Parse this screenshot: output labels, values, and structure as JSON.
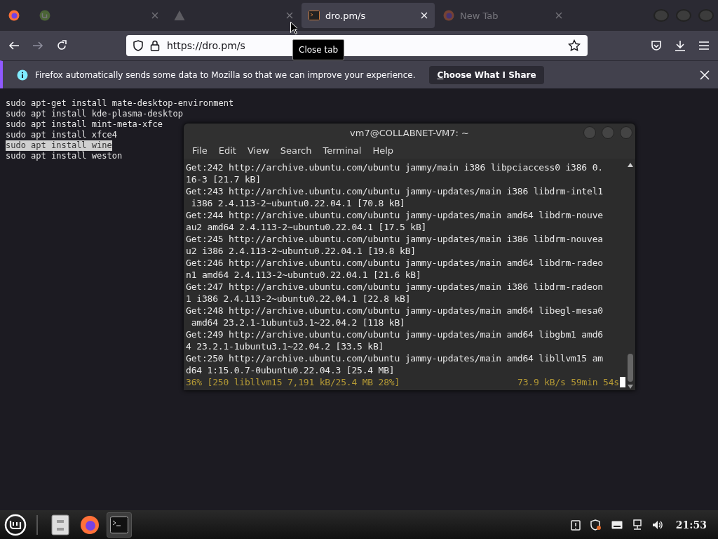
{
  "browser": {
    "tabs": [
      {
        "kind": "mint",
        "selected": false
      },
      {
        "kind": "warning",
        "selected": false
      },
      {
        "kind": "terminal",
        "title": "dro.pm/s",
        "selected": true
      },
      {
        "kind": "firefox",
        "title": "New Tab",
        "selected": false
      }
    ],
    "url": "https://dro.pm/s",
    "tooltip": "Close tab",
    "notification": {
      "message": "Firefox automatically sends some data to Mozilla so that we can improve your experience.",
      "button": "Choose What I Share"
    }
  },
  "page_lines": [
    {
      "text": "sudo apt-get install mate-desktop-environment",
      "selected": false
    },
    {
      "text": "sudo apt install kde-plasma-desktop",
      "selected": false
    },
    {
      "text": "sudo apt install mint-meta-xfce",
      "selected": false
    },
    {
      "text": "sudo apt install xfce4",
      "selected": false
    },
    {
      "text": "sudo apt install wine",
      "selected": true
    },
    {
      "text": "sudo apt install weston",
      "selected": false
    }
  ],
  "terminal": {
    "title": "vm7@COLLABNET-VM7: ~",
    "menu": [
      "File",
      "Edit",
      "View",
      "Search",
      "Terminal",
      "Help"
    ],
    "lines": [
      "Get:242 http://archive.ubuntu.com/ubuntu jammy/main i386 libpciaccess0 i386 0.",
      "16-3 [21.7 kB]",
      "Get:243 http://archive.ubuntu.com/ubuntu jammy-updates/main i386 libdrm-intel1",
      " i386 2.4.113-2~ubuntu0.22.04.1 [70.8 kB]",
      "Get:244 http://archive.ubuntu.com/ubuntu jammy-updates/main amd64 libdrm-nouve",
      "au2 amd64 2.4.113-2~ubuntu0.22.04.1 [17.5 kB]",
      "Get:245 http://archive.ubuntu.com/ubuntu jammy-updates/main i386 libdrm-nouvea",
      "u2 i386 2.4.113-2~ubuntu0.22.04.1 [19.8 kB]",
      "Get:246 http://archive.ubuntu.com/ubuntu jammy-updates/main amd64 libdrm-radeo",
      "n1 amd64 2.4.113-2~ubuntu0.22.04.1 [21.6 kB]",
      "Get:247 http://archive.ubuntu.com/ubuntu jammy-updates/main i386 libdrm-radeon",
      "1 i386 2.4.113-2~ubuntu0.22.04.1 [22.8 kB]",
      "Get:248 http://archive.ubuntu.com/ubuntu jammy-updates/main amd64 libegl-mesa0",
      " amd64 23.2.1-1ubuntu3.1~22.04.2 [118 kB]",
      "Get:249 http://archive.ubuntu.com/ubuntu jammy-updates/main amd64 libgbm1 amd6",
      "4 23.2.1-1ubuntu3.1~22.04.2 [33.5 kB]",
      "Get:250 http://archive.ubuntu.com/ubuntu jammy-updates/main amd64 libllvm15 am",
      "d64 1:15.0.7-0ubuntu0.22.04.3 [25.4 MB]"
    ],
    "progress": {
      "left": "36% [250 libllvm15 7,191 kB/25.4 MB 28%]",
      "right": "73.9 kB/s 59min 54s"
    }
  },
  "taskbar": {
    "apps": [
      {
        "kind": "files",
        "selected": false
      },
      {
        "kind": "firefox",
        "selected": false
      },
      {
        "kind": "terminal",
        "selected": true
      }
    ],
    "clock": "21:53"
  }
}
